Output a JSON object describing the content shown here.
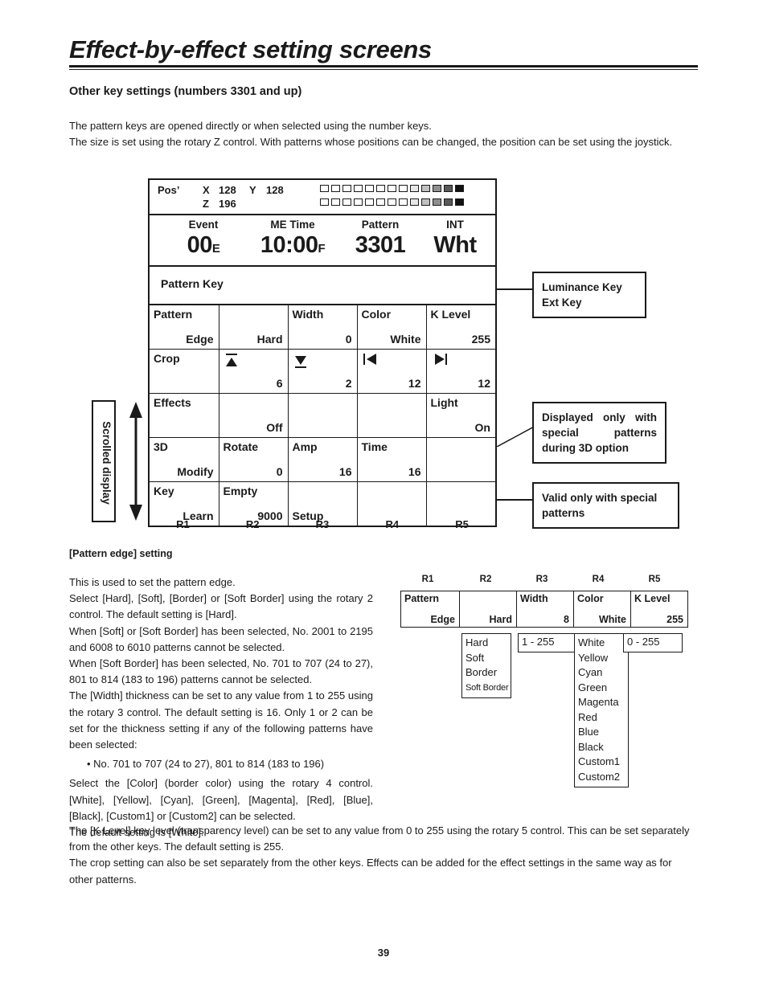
{
  "page": {
    "title": "Effect-by-effect setting screens",
    "section_title": "Other key settings (numbers 3301 and up)",
    "intro_line1": "The pattern keys are opened directly or when selected using the number keys.",
    "intro_line2": "The size is set using the rotary Z control.  With patterns whose positions can be changed, the position can be set using the joystick.",
    "page_number": "39"
  },
  "panel": {
    "pos_label": "Pos’",
    "x_label": "X",
    "x_value": "128",
    "y_label": "Y",
    "y_value": "128",
    "z_label": "Z",
    "z_value": "196",
    "bar_levels": [
      "#ffffff",
      "#ffffff",
      "#ffffff",
      "#ffffff",
      "#ffffff",
      "#ffffff",
      "#ffffff",
      "#ffffff",
      "#e8e8e8",
      "#c0c0c0",
      "#8f8f8f",
      "#5a5a5a",
      "#111111"
    ],
    "readouts": [
      {
        "label": "Event",
        "value": "00",
        "suffix": "E"
      },
      {
        "label": "ME Time",
        "value": "10:00",
        "suffix": "F"
      },
      {
        "label": "Pattern",
        "value": "3301",
        "suffix": ""
      },
      {
        "label": "INT",
        "value": "Wht",
        "suffix": ""
      }
    ],
    "pattern_key_label": "Pattern Key",
    "rows": [
      {
        "cells": [
          {
            "top": "Pattern",
            "bottom": "Edge",
            "icon": ""
          },
          {
            "top": "",
            "bottom": "Hard",
            "icon": ""
          },
          {
            "top": "Width",
            "bottom": "0",
            "icon": ""
          },
          {
            "top": "Color",
            "bottom": "White",
            "icon": ""
          },
          {
            "top": "K Level",
            "bottom": "255",
            "icon": ""
          }
        ]
      },
      {
        "cells": [
          {
            "top": "Crop",
            "bottom": "",
            "icon": ""
          },
          {
            "top": "",
            "bottom": "6",
            "icon": "crop-top-icon"
          },
          {
            "top": "",
            "bottom": "2",
            "icon": "crop-bottom-icon"
          },
          {
            "top": "",
            "bottom": "12",
            "icon": "crop-left-icon"
          },
          {
            "top": "",
            "bottom": "12",
            "icon": "crop-right-icon"
          }
        ]
      },
      {
        "cells": [
          {
            "top": "Effects",
            "bottom": "",
            "icon": ""
          },
          {
            "top": "",
            "bottom": "Off",
            "icon": ""
          },
          {
            "top": "",
            "bottom": "",
            "icon": ""
          },
          {
            "top": "",
            "bottom": "",
            "icon": ""
          },
          {
            "top": "Light",
            "bottom": "On",
            "icon": ""
          }
        ]
      },
      {
        "cells": [
          {
            "top": "3D",
            "bottom": "Modify",
            "icon": ""
          },
          {
            "top": "Rotate",
            "bottom": "0",
            "icon": ""
          },
          {
            "top": "Amp",
            "bottom": "16",
            "icon": ""
          },
          {
            "top": "Time",
            "bottom": "16",
            "icon": ""
          },
          {
            "top": "",
            "bottom": "",
            "icon": ""
          }
        ]
      },
      {
        "cells": [
          {
            "top": "Key",
            "bottom": "Learn",
            "icon": ""
          },
          {
            "top": "Empty",
            "bottom": "9000",
            "icon": ""
          },
          {
            "top": "",
            "bottom": "Setup",
            "icon": "",
            "bottom_align": "left"
          },
          {
            "top": "",
            "bottom": "",
            "icon": ""
          },
          {
            "top": "",
            "bottom": "",
            "icon": ""
          }
        ]
      }
    ],
    "rotary_labels": [
      "R1",
      "R2",
      "R3",
      "R4",
      "R5"
    ]
  },
  "callouts": {
    "luminance": "Luminance Key\nExt Key",
    "three_d": "Displayed only with special patterns during 3D option",
    "valid": "Valid only with special patterns"
  },
  "scrolled_display": {
    "label": "Scrolled display"
  },
  "pattern_edge": {
    "subhead": "[Pattern edge] setting",
    "paragraphs": [
      "This is used to set the pattern edge.",
      "Select [Hard], [Soft], [Border] or [Soft Border] using the rotary 2 control.  The default setting is [Hard].",
      "When [Soft] or [Soft Border] has been selected, No. 2001 to 2195 and 6008 to 6010 patterns cannot be selected.",
      "When [Soft Border] has been selected, No. 701 to 707 (24 to 27), 801 to 814 (183 to 196) patterns cannot be selected.",
      "The [Width] thickness can be set to any value from 1 to 255 using the rotary 3 control.  The default setting is 16.  Only 1 or 2 can be set for the thickness setting if any of the following patterns have been selected:"
    ],
    "bullet": "• No. 701 to 707 (24 to 27), 801 to 814 (183 to 196)",
    "paragraphs_after": [
      "Select the [Color] (border color) using the rotary 4 control. [White], [Yellow], [Cyan], [Green], [Magenta], [Red], [Blue], [Black], [Custom1] or [Custom2] can be selected.",
      "The default setting is [White]."
    ],
    "wide_paragraphs": [
      "The [K Level] key level (transparency level) can be set to any value from 0 to 255 using the rotary 5 control.  This can be set separately from the other keys.  The default setting is 255.",
      "The crop setting can also be set separately from the other keys.  Effects can be added for the effect settings in the same way as for other patterns."
    ]
  },
  "example": {
    "rotary_labels": [
      "R1",
      "R2",
      "R3",
      "R4",
      "R5"
    ],
    "table_cells": [
      {
        "top": "Pattern",
        "bottom": "Edge"
      },
      {
        "top": "",
        "bottom": "Hard"
      },
      {
        "top": "Width",
        "bottom": "8"
      },
      {
        "top": "Color",
        "bottom": "White"
      },
      {
        "top": "K Level",
        "bottom": "255"
      }
    ],
    "edge_options": [
      "Hard",
      "Soft",
      "Border",
      "Soft Border"
    ],
    "width_range": "1 - 255",
    "color_options": [
      "White",
      "Yellow",
      "Cyan",
      "Green",
      "Magenta",
      "Red",
      "Blue",
      "Black",
      "Custom1",
      "Custom2"
    ],
    "klevel_range": "0 - 255"
  }
}
